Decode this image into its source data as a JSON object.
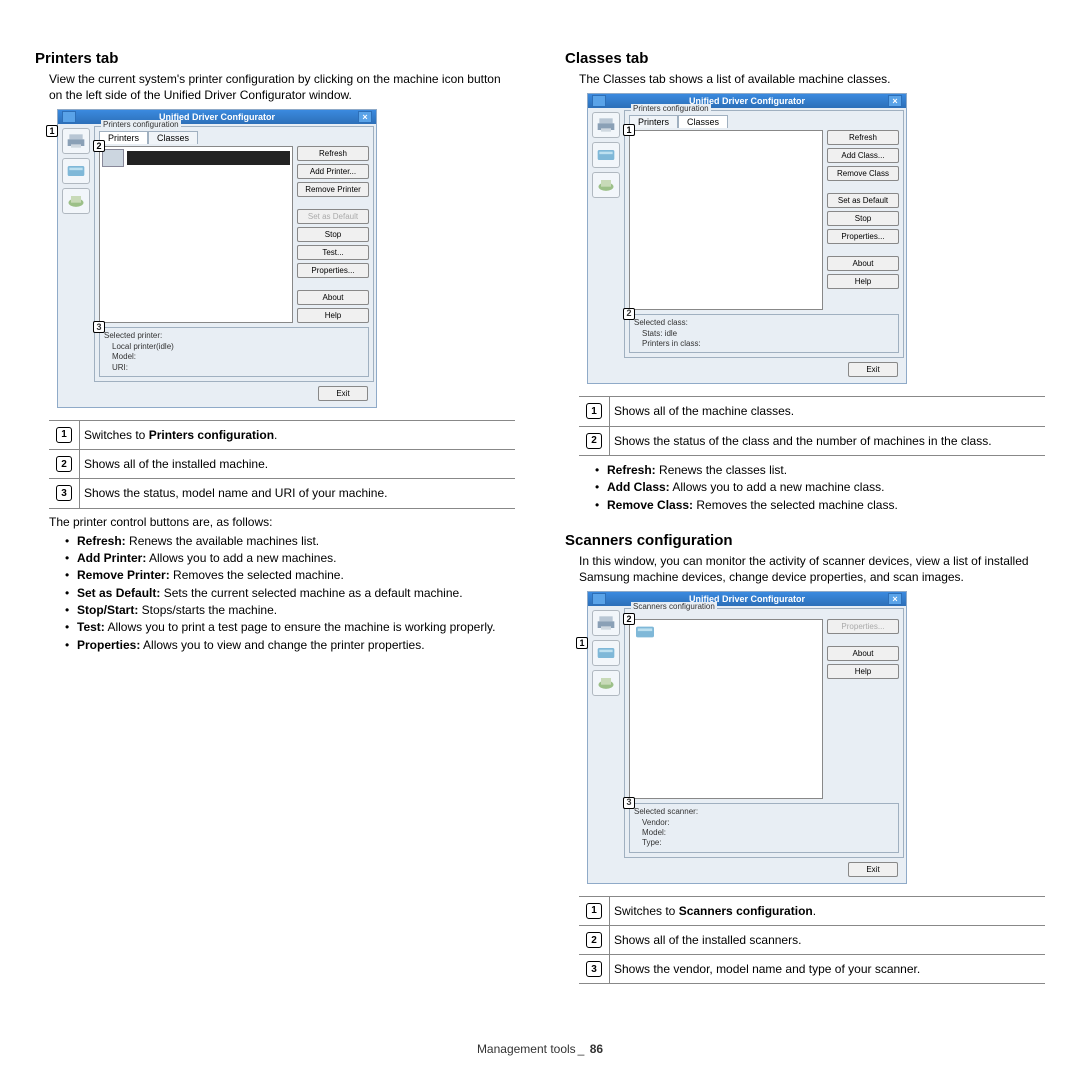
{
  "printers": {
    "heading": "Printers tab",
    "intro": "View the current system's printer configuration by clicking on the machine icon button on the left side of the Unified Driver Configurator window.",
    "window_title": "Unified Driver Configurator",
    "fieldset_label": "Printers configuration",
    "tab_printers": "Printers",
    "tab_classes": "Classes",
    "btn_refresh": "Refresh",
    "btn_add": "Add Printer...",
    "btn_remove": "Remove Printer",
    "btn_setdefault": "Set as Default",
    "btn_stop": "Stop",
    "btn_test": "Test...",
    "btn_properties": "Properties...",
    "btn_about": "About",
    "btn_help": "Help",
    "btn_exit": "Exit",
    "status_title": "Selected printer:",
    "status_l1": "Local printer(idle)",
    "status_l2": "Model:",
    "status_l3": "URI:",
    "ref": [
      "Switches to Printers configuration.",
      "Shows all of the installed machine.",
      "Shows the status, model name and URI of your machine."
    ],
    "ref_bold_0": "Printers configuration",
    "bullets_intro": "The printer control buttons are, as follows:",
    "bullets": [
      {
        "b": "Refresh:",
        "t": " Renews the available machines list."
      },
      {
        "b": "Add Printer:",
        "t": " Allows you to add a new machines."
      },
      {
        "b": "Remove Printer:",
        "t": " Removes the selected machine."
      },
      {
        "b": "Set as Default:",
        "t": " Sets the current selected machine as a default machine."
      },
      {
        "b": "Stop/Start:",
        "t": " Stops/starts the machine."
      },
      {
        "b": "Test:",
        "t": " Allows you to print a test page to ensure the machine is working properly."
      },
      {
        "b": "Properties:",
        "t": " Allows you to view and change the printer properties."
      }
    ]
  },
  "classes": {
    "heading": "Classes tab",
    "intro": "The Classes tab shows a list of available machine classes.",
    "window_title": "Unified Driver Configurator",
    "fieldset_label": "Printers configuration",
    "tab_printers": "Printers",
    "tab_classes": "Classes",
    "btn_refresh": "Refresh",
    "btn_add": "Add Class...",
    "btn_remove": "Remove Class",
    "btn_setdefault": "Set as Default",
    "btn_stop": "Stop",
    "btn_properties": "Properties...",
    "btn_about": "About",
    "btn_help": "Help",
    "btn_exit": "Exit",
    "status_title": "Selected class:",
    "status_l1": "Stats: idle",
    "status_l2": "Printers in class:",
    "ref": [
      "Shows all of the machine classes.",
      "Shows the status of the class and the number of machines in the class."
    ],
    "bullets": [
      {
        "b": "Refresh:",
        "t": " Renews the classes list."
      },
      {
        "b": "Add Class:",
        "t": " Allows you to add a new machine class."
      },
      {
        "b": "Remove Class:",
        "t": " Removes the selected machine class."
      }
    ]
  },
  "scanners": {
    "heading": "Scanners configuration",
    "intro": "In this window, you can monitor the activity of scanner devices, view a list of installed Samsung machine devices, change device properties, and scan images.",
    "window_title": "Unified Driver Configurator",
    "fieldset_label": "Scanners configuration",
    "btn_properties": "Properties...",
    "btn_about": "About",
    "btn_help": "Help",
    "btn_exit": "Exit",
    "status_title": "Selected scanner:",
    "status_l1": "Vendor:",
    "status_l2": "Model:",
    "status_l3": "Type:",
    "ref": [
      "Switches to Scanners configuration.",
      "Shows all of the installed scanners.",
      "Shows the vendor, model name and type of your scanner."
    ],
    "ref_bold_0": "Scanners configuration"
  },
  "footer": {
    "text": "Management tools",
    "page": "86"
  }
}
